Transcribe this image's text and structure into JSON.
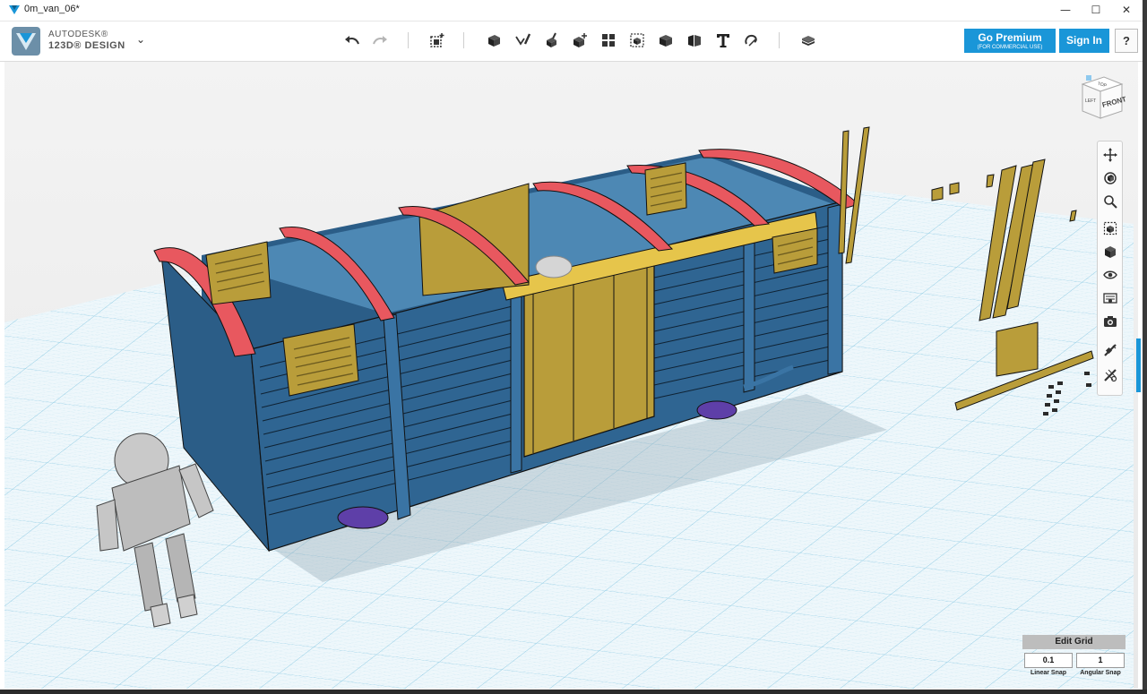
{
  "window": {
    "title": "0m_van_06*",
    "minimize": "—",
    "maximize": "☐",
    "close": "✕"
  },
  "brand": {
    "line1": "AUTODESK®",
    "line2": "123D® DESIGN",
    "menu_chevron": "⌄"
  },
  "toolbar": {
    "icons": [
      "undo-icon",
      "redo-icon",
      "transform-icon",
      "primitives-icon",
      "sketch-icon",
      "construct-icon",
      "modify-icon",
      "pattern-icon",
      "grouping-icon",
      "combine-icon",
      "measure-icon",
      "text-icon",
      "snap-icon",
      "material-icon"
    ]
  },
  "header_buttons": {
    "premium_label": "Go Premium",
    "premium_sub": "(FOR COMMERCIAL USE)",
    "signin_label": "Sign In",
    "help_label": "?"
  },
  "viewcube": {
    "top_label": "TOP",
    "front_label": "FRONT",
    "left_label": "LEFT"
  },
  "nav_tools": [
    "pan-icon",
    "orbit-icon",
    "zoom-icon",
    "fit-icon",
    "view-mode-icon",
    "visibility-icon",
    "materials-outline-icon",
    "screenshot-icon",
    "snap-tool-icon",
    "physical-material-icon"
  ],
  "grid_panel": {
    "title": "Edit Grid",
    "linear_value": "0.1",
    "angular_value": "1",
    "linear_label": "Linear Snap",
    "angular_label": "Angular Snap"
  },
  "colors": {
    "accent": "#1a96d8",
    "van_body": "#2b5d87",
    "van_roof_ribs": "#e8585f",
    "van_doors": "#b99d3a",
    "grid_line": "#a8d6ea"
  }
}
